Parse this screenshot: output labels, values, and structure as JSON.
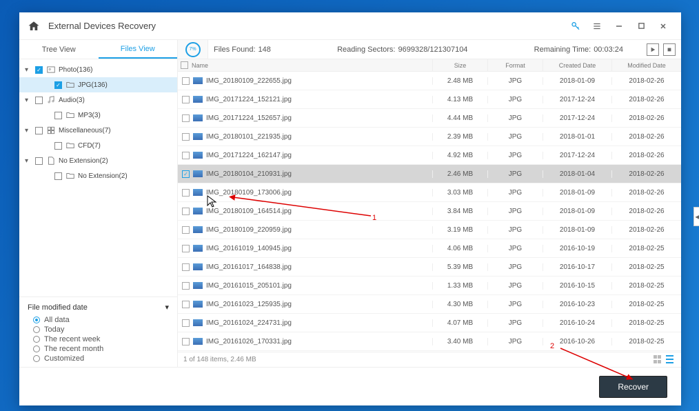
{
  "titlebar": {
    "title": "External Devices Recovery"
  },
  "tabs": {
    "tree": "Tree View",
    "files": "Files View"
  },
  "progress": {
    "pct": "7%"
  },
  "info": {
    "files_label": "Files Found:",
    "files_value": "148",
    "sectors_label": "Reading Sectors:",
    "sectors_value": "9699328/121307104",
    "remain_label": "Remaining Time:",
    "remain_value": "00:03:24"
  },
  "tree": {
    "photo": "Photo(136)",
    "jpg": "JPG(136)",
    "audio": "Audio(3)",
    "mp3": "MP3(3)",
    "misc": "Miscellaneous(7)",
    "cfd": "CFD(7)",
    "noext": "No Extension(2)",
    "noext2": "No Extension(2)"
  },
  "filters": {
    "title": "File modified date",
    "all": "All data",
    "today": "Today",
    "week": "The recent week",
    "month": "The recent month",
    "custom": "Customized"
  },
  "cols": {
    "name": "Name",
    "size": "Size",
    "fmt": "Format",
    "cd": "Created Date",
    "md": "Modified Date"
  },
  "rows": [
    {
      "name": "IMG_20180109_222655.jpg",
      "size": "2.48 MB",
      "fmt": "JPG",
      "cd": "2018-01-09",
      "md": "2018-02-26",
      "sel": false,
      "chk": false
    },
    {
      "name": "IMG_20171224_152121.jpg",
      "size": "4.13 MB",
      "fmt": "JPG",
      "cd": "2017-12-24",
      "md": "2018-02-26",
      "sel": false,
      "chk": false
    },
    {
      "name": "IMG_20171224_152657.jpg",
      "size": "4.44 MB",
      "fmt": "JPG",
      "cd": "2017-12-24",
      "md": "2018-02-26",
      "sel": false,
      "chk": false
    },
    {
      "name": "IMG_20180101_221935.jpg",
      "size": "2.39 MB",
      "fmt": "JPG",
      "cd": "2018-01-01",
      "md": "2018-02-26",
      "sel": false,
      "chk": false
    },
    {
      "name": "IMG_20171224_162147.jpg",
      "size": "4.92 MB",
      "fmt": "JPG",
      "cd": "2017-12-24",
      "md": "2018-02-26",
      "sel": false,
      "chk": false
    },
    {
      "name": "IMG_20180104_210931.jpg",
      "size": "2.46 MB",
      "fmt": "JPG",
      "cd": "2018-01-04",
      "md": "2018-02-26",
      "sel": true,
      "chk": true
    },
    {
      "name": "IMG_20180109_173006.jpg",
      "size": "3.03 MB",
      "fmt": "JPG",
      "cd": "2018-01-09",
      "md": "2018-02-26",
      "sel": false,
      "chk": false
    },
    {
      "name": "IMG_20180109_164514.jpg",
      "size": "3.84 MB",
      "fmt": "JPG",
      "cd": "2018-01-09",
      "md": "2018-02-26",
      "sel": false,
      "chk": false
    },
    {
      "name": "IMG_20180109_220959.jpg",
      "size": "3.19 MB",
      "fmt": "JPG",
      "cd": "2018-01-09",
      "md": "2018-02-26",
      "sel": false,
      "chk": false
    },
    {
      "name": "IMG_20161019_140945.jpg",
      "size": "4.06 MB",
      "fmt": "JPG",
      "cd": "2016-10-19",
      "md": "2018-02-25",
      "sel": false,
      "chk": false
    },
    {
      "name": "IMG_20161017_164838.jpg",
      "size": "5.39 MB",
      "fmt": "JPG",
      "cd": "2016-10-17",
      "md": "2018-02-25",
      "sel": false,
      "chk": false
    },
    {
      "name": "IMG_20161015_205101.jpg",
      "size": "1.33 MB",
      "fmt": "JPG",
      "cd": "2016-10-15",
      "md": "2018-02-25",
      "sel": false,
      "chk": false
    },
    {
      "name": "IMG_20161023_125935.jpg",
      "size": "4.30 MB",
      "fmt": "JPG",
      "cd": "2016-10-23",
      "md": "2018-02-25",
      "sel": false,
      "chk": false
    },
    {
      "name": "IMG_20161024_224731.jpg",
      "size": "4.07 MB",
      "fmt": "JPG",
      "cd": "2016-10-24",
      "md": "2018-02-25",
      "sel": false,
      "chk": false
    },
    {
      "name": "IMG_20161026_170331.jpg",
      "size": "3.40 MB",
      "fmt": "JPG",
      "cd": "2016-10-26",
      "md": "2018-02-25",
      "sel": false,
      "chk": false
    }
  ],
  "status": "1 of 148 items, 2.46 MB",
  "recover": "Recover",
  "ann": {
    "l1": "1",
    "l2": "2"
  }
}
